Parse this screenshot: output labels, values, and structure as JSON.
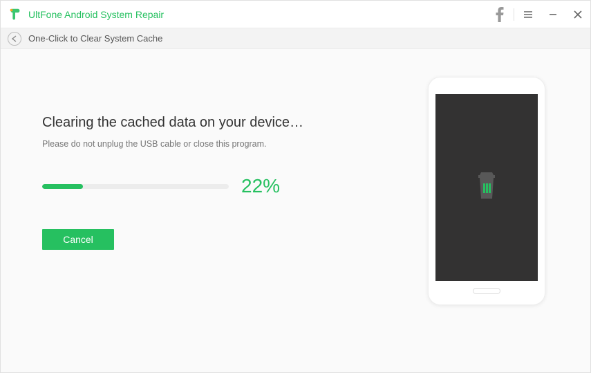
{
  "titlebar": {
    "app_title": "UltFone Android System Repair"
  },
  "breadcrumb": {
    "label": "One-Click to Clear System Cache"
  },
  "main": {
    "heading": "Clearing the cached data on your device…",
    "subtext": "Please do not unplug the USB cable or close this program.",
    "progress_percent_label": "22%",
    "progress_percent_value": 22,
    "cancel_label": "Cancel"
  },
  "colors": {
    "accent": "#26c060",
    "phone_screen": "#333232"
  }
}
